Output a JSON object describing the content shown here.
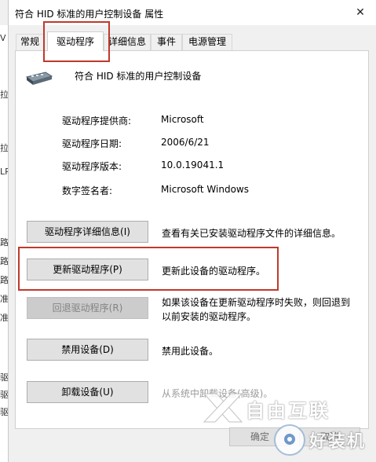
{
  "window": {
    "title": "符合 HID 标准的用户控制设备 属性",
    "close_glyph": "✕"
  },
  "tabs": [
    {
      "label": "常规"
    },
    {
      "label": "驱动程序"
    },
    {
      "label": "详细信息"
    },
    {
      "label": "事件"
    },
    {
      "label": "电源管理"
    }
  ],
  "device": {
    "name": "符合 HID 标准的用户控制设备",
    "icon": "hid-device-icon"
  },
  "driver_info": [
    {
      "label": "驱动程序提供商:",
      "value": "Microsoft"
    },
    {
      "label": "驱动程序日期:",
      "value": "2006/6/21"
    },
    {
      "label": "驱动程序版本:",
      "value": "10.0.19041.1"
    },
    {
      "label": "数字签名者:",
      "value": "Microsoft Windows"
    }
  ],
  "actions": [
    {
      "button": "驱动程序详细信息(I)",
      "desc": "查看有关已安装驱动程序文件的详细信息。",
      "enabled": true
    },
    {
      "button": "更新驱动程序(P)",
      "desc": "更新此设备的驱动程序。",
      "enabled": true
    },
    {
      "button": "回退驱动程序(R)",
      "desc": "如果该设备在更新驱动程序时失败，则回退到以前安装的驱动程序。",
      "desc_line1": "如果该设备在更新驱动程序时失败，则回退到",
      "desc_line2": "以前安装的驱动程序。",
      "enabled": false
    },
    {
      "button": "禁用设备(D)",
      "desc": "禁用此设备。",
      "enabled": true
    },
    {
      "button": "卸载设备(U)",
      "desc": "从系统中卸载设备(高级)。",
      "enabled": true
    }
  ],
  "footer": {
    "ok": "确定",
    "cancel": "取消"
  },
  "background_fragments": [
    "V",
    "拉",
    "拉",
    "LP",
    "路",
    "路",
    "路",
    "准",
    "准",
    "驱",
    "驱",
    "驱"
  ],
  "watermark": {
    "text_top": "自由互联",
    "text_bottom": "好装机"
  },
  "colors": {
    "highlight": "#c0392b",
    "dialog_bg": "#f0f0f0",
    "panel_bg": "#ffffff",
    "button_bg": "#e1e1e1",
    "disabled_text": "#838383"
  }
}
